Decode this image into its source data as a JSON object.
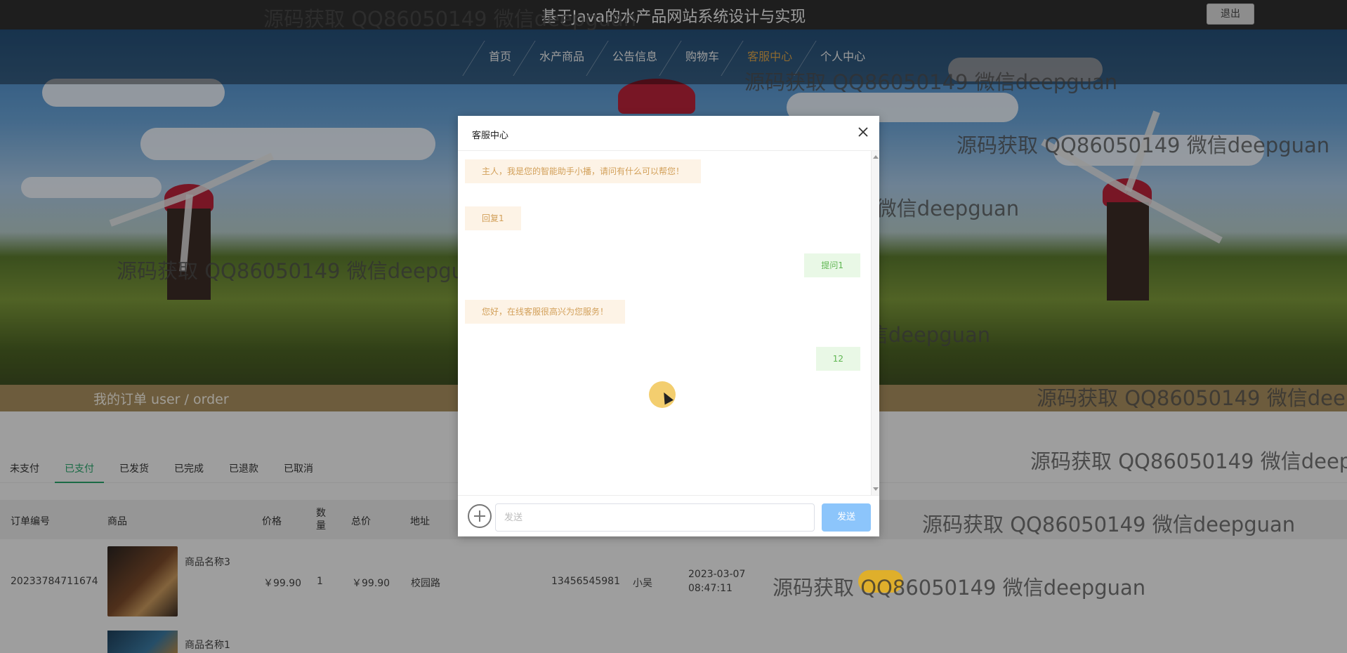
{
  "site": {
    "title": "基于Java的水产品网站系统设计与实现",
    "logout": "退出"
  },
  "nav": [
    {
      "label": "首页",
      "active": false
    },
    {
      "label": "水产商品",
      "active": false
    },
    {
      "label": "公告信息",
      "active": false
    },
    {
      "label": "购物车",
      "active": false
    },
    {
      "label": "客服中心",
      "active": true
    },
    {
      "label": "个人中心",
      "active": false
    }
  ],
  "order_band": {
    "title": "我的订单  user / order"
  },
  "tabs": [
    {
      "label": "未支付",
      "active": false
    },
    {
      "label": "已支付",
      "active": true
    },
    {
      "label": "已发货",
      "active": false
    },
    {
      "label": "已完成",
      "active": false
    },
    {
      "label": "已退款",
      "active": false
    },
    {
      "label": "已取消",
      "active": false
    }
  ],
  "table": {
    "headers": {
      "order_no": "订单编号",
      "product": "商品",
      "price": "价格",
      "qty": "数量",
      "total": "总价",
      "address": "地址"
    },
    "rows": [
      {
        "order_no": "20233784711674",
        "product": "商品名称3",
        "price": "￥99.90",
        "qty": "1",
        "total": "￥99.90",
        "address": "校园路",
        "phone": "13456545981",
        "name": "小吴",
        "date": "2023-03-07",
        "time": "08:47:11"
      },
      {
        "product": "商品名称1"
      }
    ]
  },
  "dialog": {
    "title": "客服中心",
    "messages": [
      {
        "side": "left",
        "text": "主人，我是您的智能助手小播，请问有什么可以帮您！"
      },
      {
        "side": "left",
        "text": "回复1"
      },
      {
        "side": "right",
        "text": "提问1"
      },
      {
        "side": "left",
        "text": "您好，在线客服很高兴为您服务！"
      },
      {
        "side": "right",
        "text": "12"
      }
    ],
    "input_placeholder": "发送",
    "send_label": "发送"
  },
  "watermark": "源码获取 QQ86050149 微信deepguan",
  "colors": {
    "accent": "#d8a24a",
    "tab_active": "#29a36a",
    "send_button": "#8cc5fb",
    "bubble_left_bg": "#fdf3e6",
    "bubble_right_bg": "#e9f8e6"
  }
}
